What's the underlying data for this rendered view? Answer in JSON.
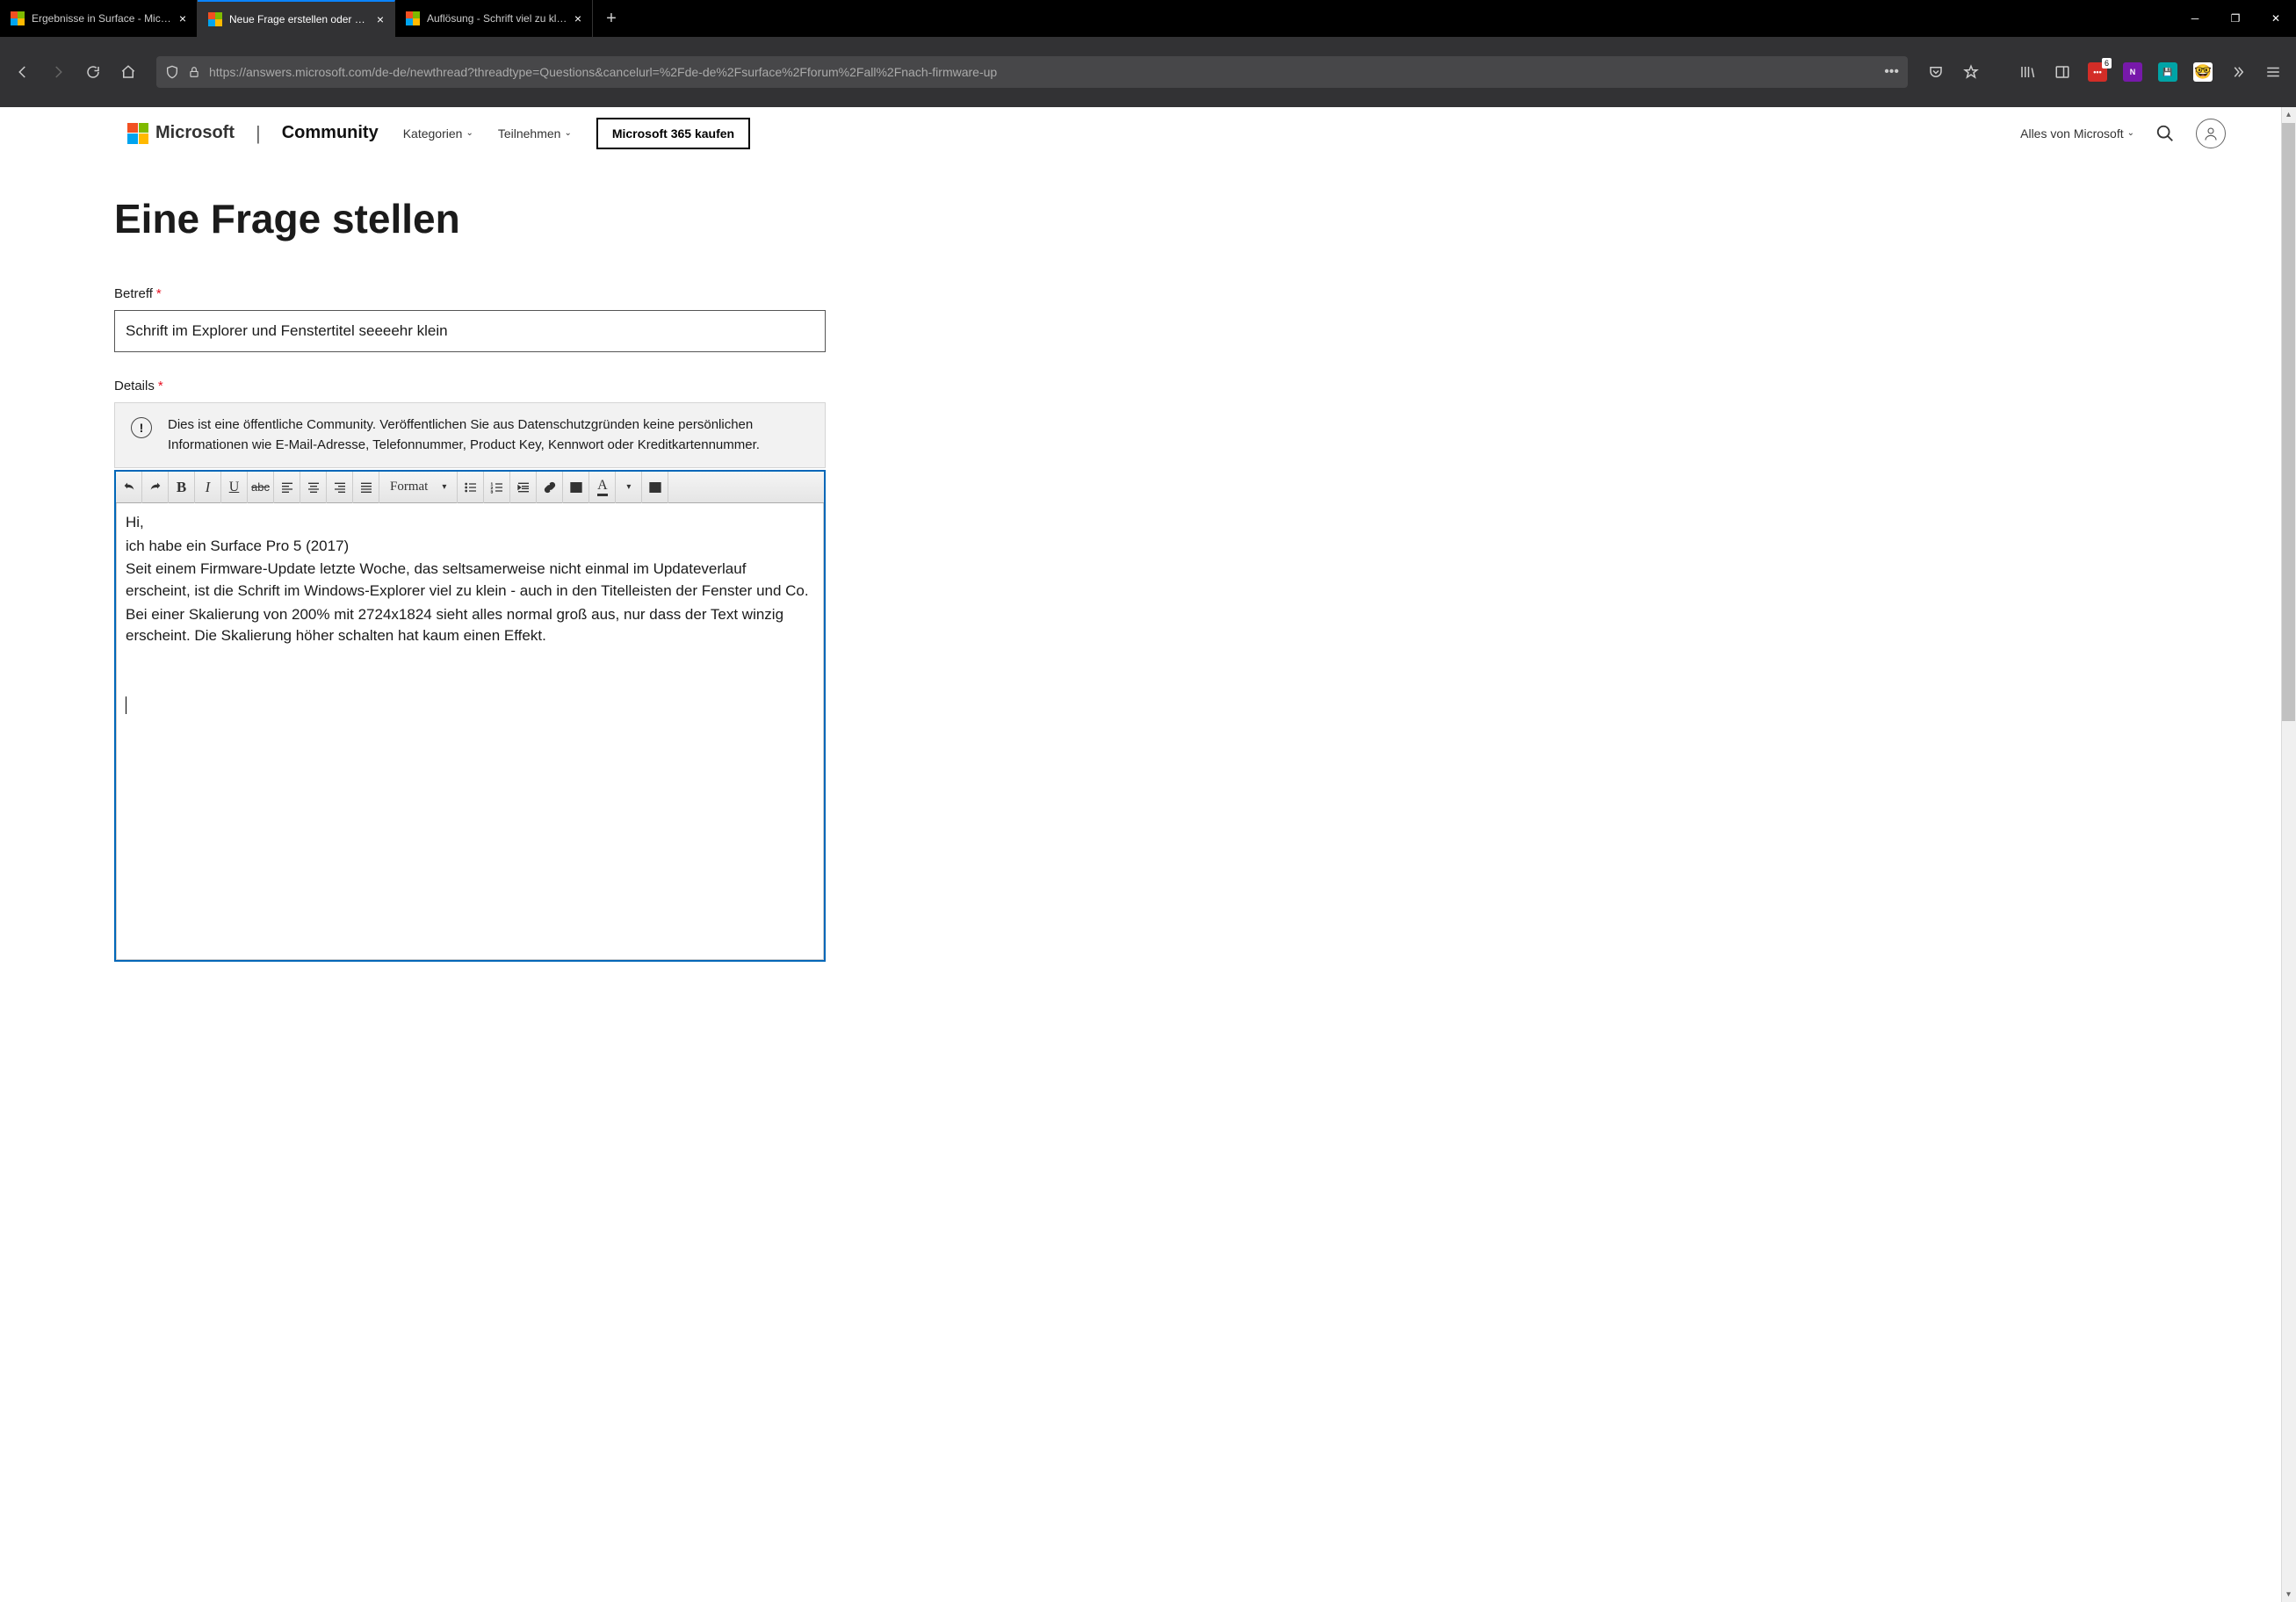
{
  "browser": {
    "tabs": [
      {
        "title": "Ergebnisse in Surface - Microsoft Community"
      },
      {
        "title": "Neue Frage erstellen oder Diskussion starten"
      },
      {
        "title": "Auflösung - Schrift viel zu klein - Microsoft Com"
      }
    ],
    "url": "https://answers.microsoft.com/de-de/newthread?threadtype=Questions&cancelurl=%2Fde-de%2Fsurface%2Fforum%2Fall%2Fnach-firmware-up",
    "ext_badge": "6"
  },
  "nav": {
    "brand1": "Microsoft",
    "brand2": "Community",
    "categories": "Kategorien",
    "participate": "Teilnehmen",
    "buy": "Microsoft 365 kaufen",
    "all": "Alles von Microsoft"
  },
  "page": {
    "heading": "Eine Frage stellen",
    "subject_label": "Betreff",
    "subject_value": "Schrift im Explorer und Fenstertitel seeeehr klein",
    "details_label": "Details",
    "notice": "Dies ist eine öffentliche Community. Veröffentlichen Sie aus Datenschutzgründen keine persönlichen Informationen wie E-Mail-Adresse, Telefonnummer, Product Key, Kennwort oder Kreditkartennummer.",
    "format_label": "Format",
    "body_lines": [
      "Hi,",
      "ich habe ein Surface Pro 5 (2017)",
      "Seit einem Firmware-Update letzte Woche, das seltsamerweise nicht einmal im Updateverlauf erscheint, ist die Schrift im Windows-Explorer viel zu klein - auch in den Titelleisten der Fenster und Co.",
      "Bei einer Skalierung von 200% mit 2724x1824 sieht alles normal groß aus, nur dass der Text winzig erscheint. Die Skalierung höher schalten hat kaum einen Effekt."
    ]
  }
}
